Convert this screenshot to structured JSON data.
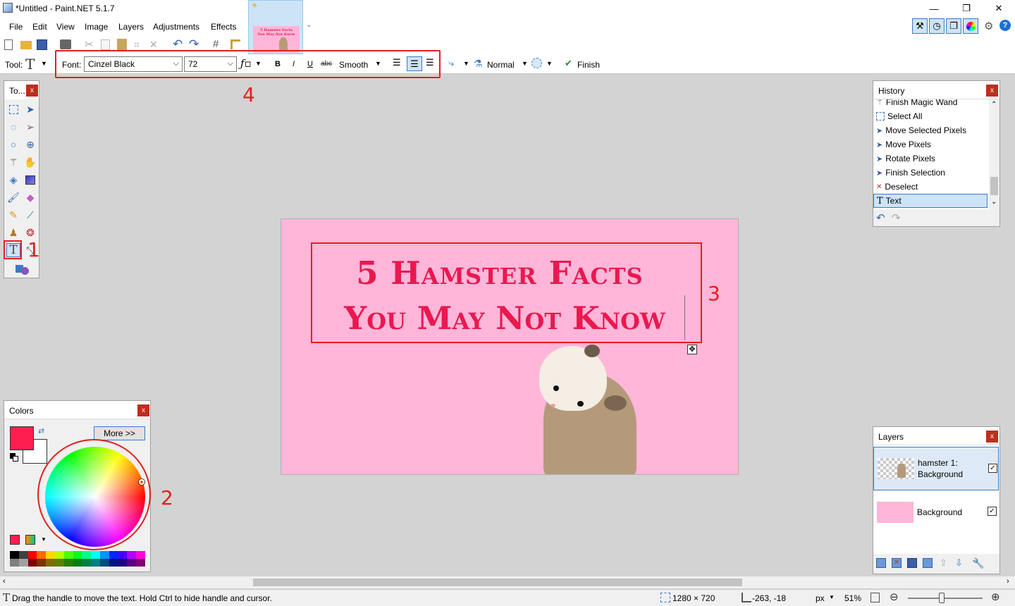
{
  "window": {
    "title": "*Untitled - Paint.NET 5.1.7",
    "minimize": "—",
    "maximize": "❐",
    "close": "✕"
  },
  "menu": [
    "File",
    "Edit",
    "View",
    "Image",
    "Layers",
    "Adjustments",
    "Effects"
  ],
  "thumbnail": {
    "line1": "5 Hamster Facts",
    "line2": "You May Not Know"
  },
  "toolbar": {
    "tool_label": "Tool:",
    "font_label": "Font:",
    "font_value": "Cinzel Black",
    "size_value": "72",
    "bold": "B",
    "italic": "I",
    "underline": "U",
    "strike": "abc",
    "antialias": "Smooth",
    "blend": "Normal",
    "finish": "Finish"
  },
  "annotations": {
    "a1": "1",
    "a2": "2",
    "a3": "3",
    "a4": "4"
  },
  "tools_panel": {
    "title": "To..."
  },
  "canvas": {
    "line1": "5 Hamster Facts",
    "line2": "You May Not Know",
    "bg": "#ffb6d9",
    "text_color": "#e8194f"
  },
  "history": {
    "title": "History",
    "items": [
      "Finish Magic Wand",
      "Select All",
      "Move Selected Pixels",
      "Move Pixels",
      "Rotate Pixels",
      "Finish Selection",
      "Deselect",
      "Text"
    ]
  },
  "layers": {
    "title": "Layers",
    "items": [
      {
        "name_line1": "hamster 1:",
        "name_line2": "Background"
      },
      {
        "name_line1": "Background",
        "name_line2": ""
      }
    ]
  },
  "colors": {
    "title": "Colors",
    "more": "More >>",
    "primary": "#ff1e4f",
    "secondary": "#ffffff"
  },
  "status": {
    "message": "Drag the handle to move the text. Hold Ctrl to hide handle and cursor.",
    "size": "1280 × 720",
    "position": "-263, -18",
    "unit": "px",
    "zoom": "51%"
  },
  "accent": "#e51e1e"
}
